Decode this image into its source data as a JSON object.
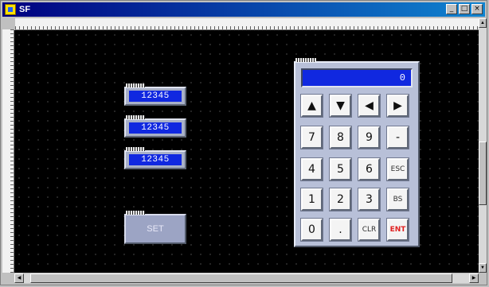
{
  "window": {
    "title": "SF",
    "buttons": {
      "minimize": "_",
      "maximize": "□",
      "close": "×"
    }
  },
  "fields": [
    {
      "value": "12345"
    },
    {
      "value": "12345"
    },
    {
      "value": "12345"
    }
  ],
  "set_button": {
    "label": "SET"
  },
  "keypad": {
    "display": "0",
    "keys": {
      "up": "▲",
      "down": "▼",
      "left": "◀",
      "right": "▶",
      "k7": "7",
      "k8": "8",
      "k9": "9",
      "minus": "-",
      "k4": "4",
      "k5": "5",
      "k6": "6",
      "esc": "ESC",
      "k1": "1",
      "k2": "2",
      "k3": "3",
      "bs": "BS",
      "k0": "0",
      "dot": ".",
      "clr": "CLR",
      "ent": "ENT"
    }
  },
  "scroll": {
    "up": "▲",
    "down": "▼",
    "left": "◀",
    "right": "▶"
  }
}
